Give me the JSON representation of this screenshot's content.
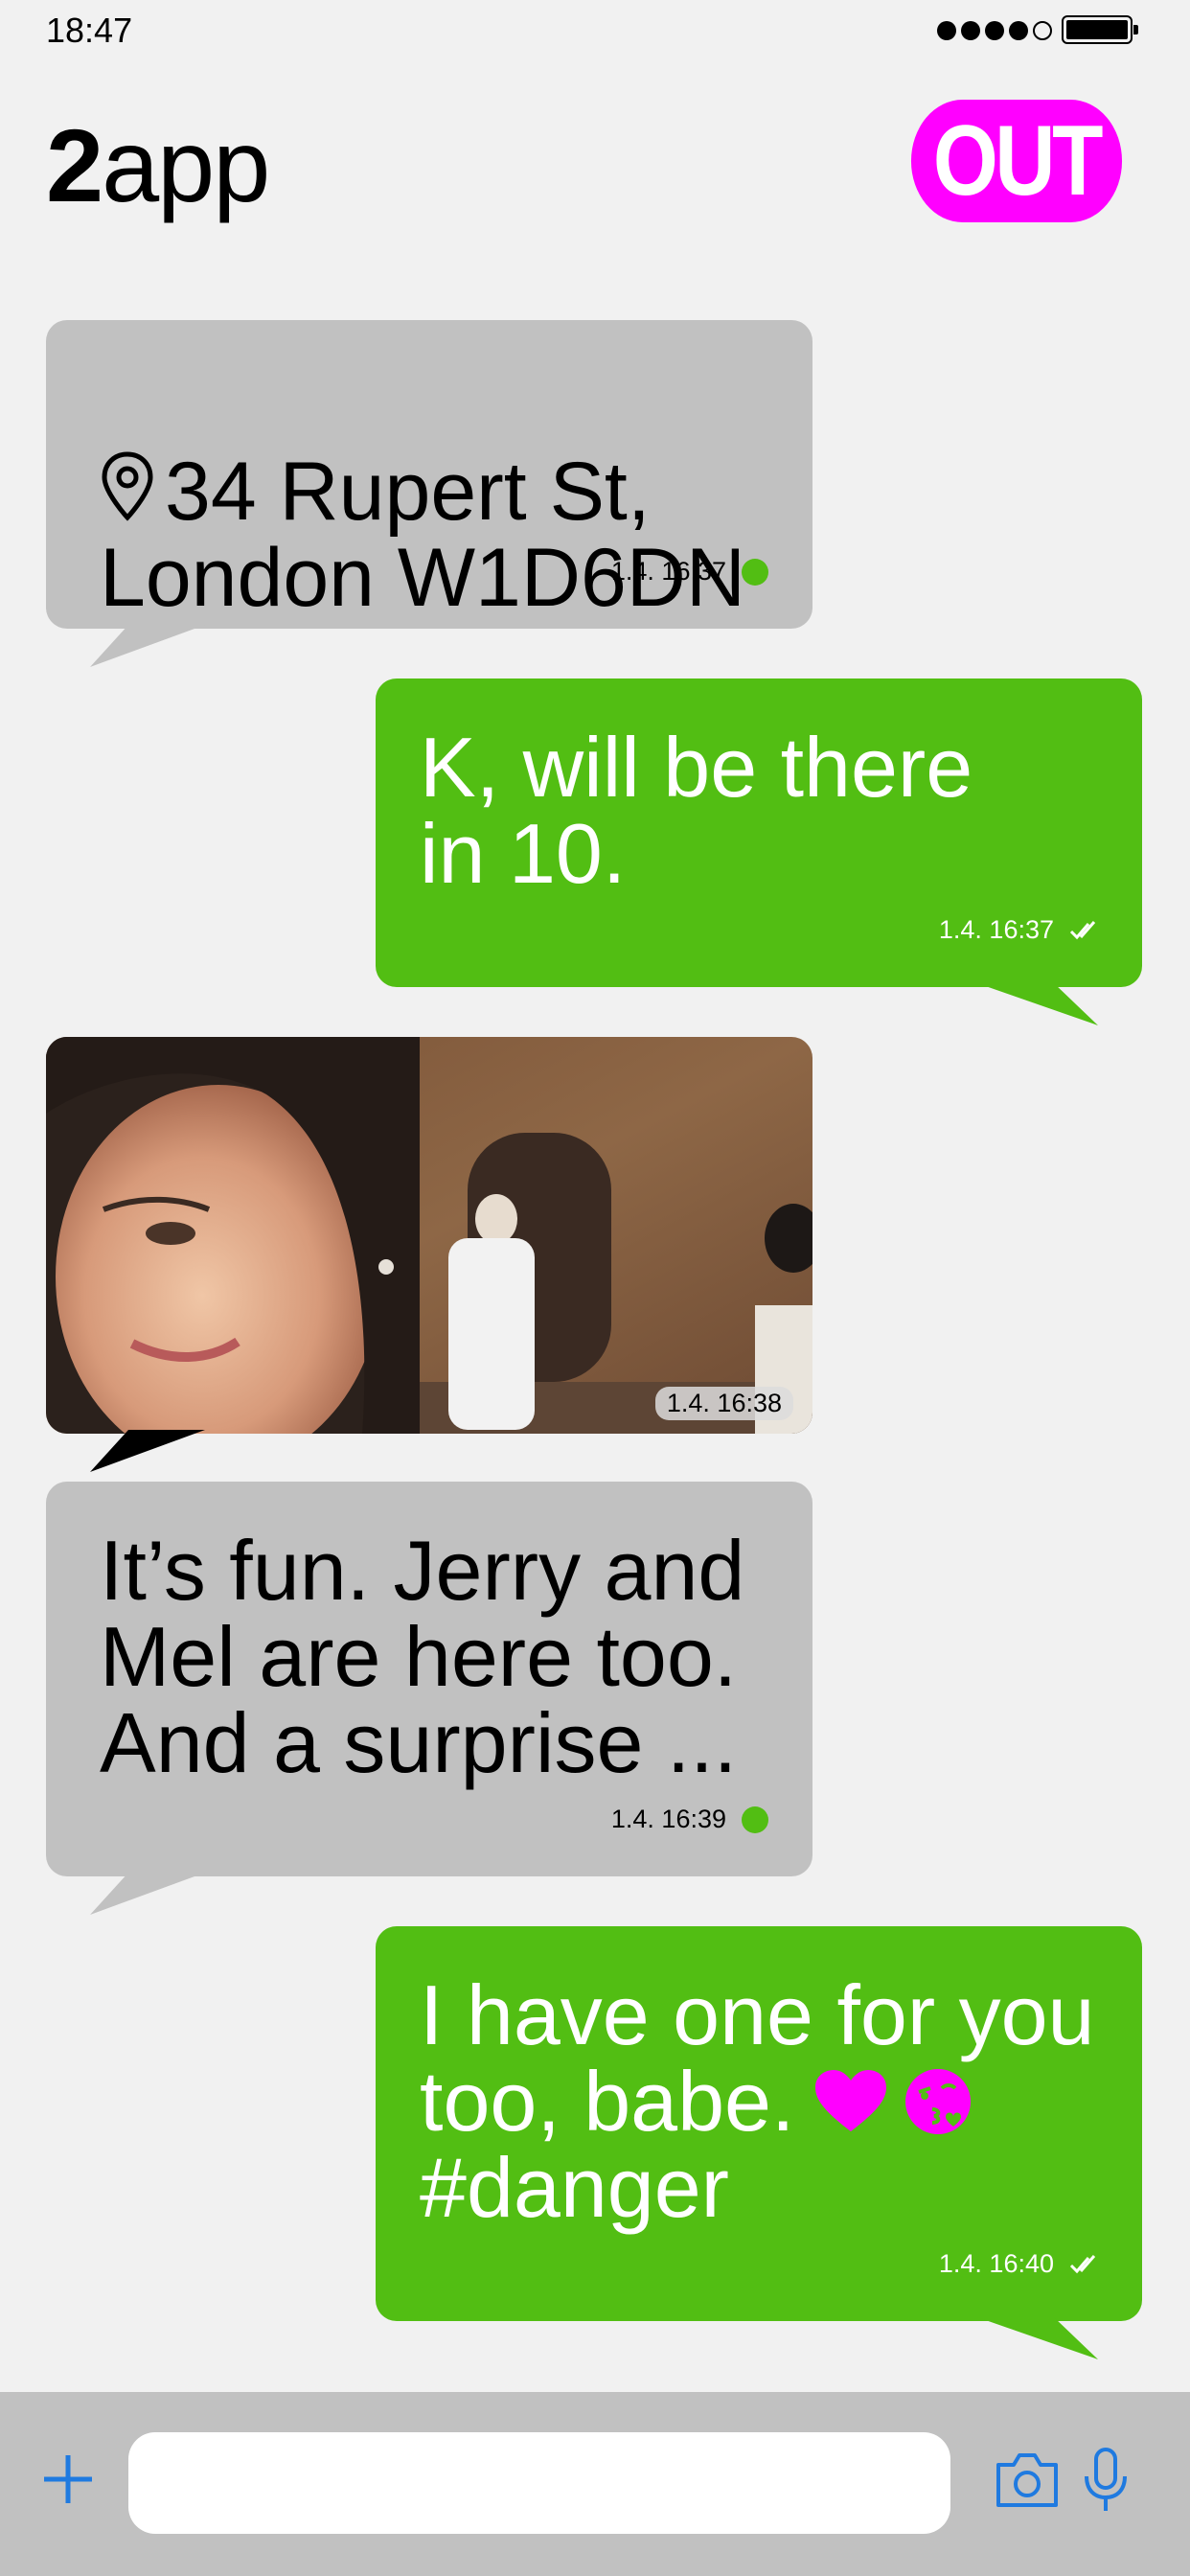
{
  "status_bar": {
    "time": "18:47",
    "signal_bars_filled": 4,
    "signal_bars_total": 5
  },
  "header": {
    "brand_number": "2",
    "brand_word": "app",
    "out_label": "OUT"
  },
  "colors": {
    "incoming_bubble": "#c1c1c1",
    "outgoing_bubble": "#52be13",
    "accent_magenta": "#ff00ff",
    "composer_icons": "#1f7ae0"
  },
  "messages": [
    {
      "direction": "incoming",
      "kind": "location",
      "icon": "map-pin-icon",
      "text": "34 Rupert St,\nLondon W1D6DN",
      "timestamp": "1.4. 16:37",
      "status": "green-dot"
    },
    {
      "direction": "outgoing",
      "kind": "text",
      "text": "K, will be there\nin 10.",
      "timestamp": "1.4. 16:37",
      "status": "double-check-icon"
    },
    {
      "direction": "incoming",
      "kind": "photo",
      "timestamp": "1.4. 16:38"
    },
    {
      "direction": "incoming",
      "kind": "text",
      "text": "It’s fun. Jerry and\nMel are here too.\nAnd a surprise ...",
      "timestamp": "1.4. 16:39",
      "status": "green-dot"
    },
    {
      "direction": "outgoing",
      "kind": "text",
      "text_line1": "I have one for you",
      "text_line2": "too, babe.",
      "text_line3": "#danger",
      "emojis": [
        "heart-icon",
        "kiss-face-icon"
      ],
      "timestamp": "1.4. 16:40",
      "status": "double-check-icon"
    }
  ],
  "composer": {
    "input_value": "",
    "input_placeholder": ""
  }
}
